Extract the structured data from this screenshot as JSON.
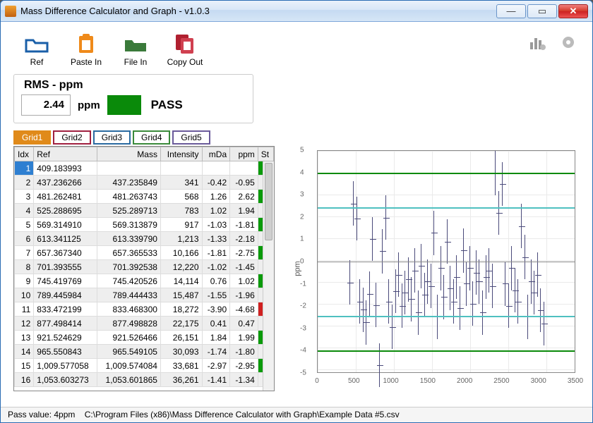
{
  "window": {
    "title": "Mass Difference Calculator and Graph - v1.0.3"
  },
  "toolbar": {
    "ref": "Ref",
    "paste": "Paste In",
    "filein": "File In",
    "copy": "Copy Out"
  },
  "rms": {
    "title": "RMS - ppm",
    "value": "2.44",
    "unit": "ppm",
    "status": "PASS",
    "status_color": "#0a8a0a"
  },
  "tabs": [
    {
      "label": "Grid1",
      "color": "#e08a1a",
      "selected": true
    },
    {
      "label": "Grid2",
      "color": "#a02040",
      "selected": false
    },
    {
      "label": "Grid3",
      "color": "#2a6aa0",
      "selected": false
    },
    {
      "label": "Grid4",
      "color": "#3a8a3a",
      "selected": false
    },
    {
      "label": "Grid5",
      "color": "#6a5a9a",
      "selected": false
    }
  ],
  "grid": {
    "headers": [
      "Idx",
      "Ref",
      "Mass",
      "Intensity",
      "mDa",
      "ppm",
      "St"
    ],
    "rows": [
      {
        "idx": 1,
        "ref": "409.183993",
        "mass": "",
        "intensity": "",
        "mda": "",
        "ppm": "",
        "st": "green"
      },
      {
        "idx": 2,
        "ref": "437.236266",
        "mass": "437.235849",
        "intensity": "341",
        "mda": "-0.42",
        "ppm": "-0.95",
        "st": "green"
      },
      {
        "idx": 3,
        "ref": "481.262481",
        "mass": "481.263743",
        "intensity": "568",
        "mda": "1.26",
        "ppm": "2.62",
        "st": "green"
      },
      {
        "idx": 4,
        "ref": "525.288695",
        "mass": "525.289713",
        "intensity": "783",
        "mda": "1.02",
        "ppm": "1.94",
        "st": "green"
      },
      {
        "idx": 5,
        "ref": "569.314910",
        "mass": "569.313879",
        "intensity": "917",
        "mda": "-1.03",
        "ppm": "-1.81",
        "st": "green"
      },
      {
        "idx": 6,
        "ref": "613.341125",
        "mass": "613.339790",
        "intensity": "1,213",
        "mda": "-1.33",
        "ppm": "-2.18",
        "st": "green"
      },
      {
        "idx": 7,
        "ref": "657.367340",
        "mass": "657.365533",
        "intensity": "10,166",
        "mda": "-1.81",
        "ppm": "-2.75",
        "st": "green"
      },
      {
        "idx": 8,
        "ref": "701.393555",
        "mass": "701.392538",
        "intensity": "12,220",
        "mda": "-1.02",
        "ppm": "-1.45",
        "st": "green"
      },
      {
        "idx": 9,
        "ref": "745.419769",
        "mass": "745.420526",
        "intensity": "14,114",
        "mda": "0.76",
        "ppm": "1.02",
        "st": "green"
      },
      {
        "idx": 10,
        "ref": "789.445984",
        "mass": "789.444433",
        "intensity": "15,487",
        "mda": "-1.55",
        "ppm": "-1.96",
        "st": "green"
      },
      {
        "idx": 11,
        "ref": "833.472199",
        "mass": "833.468300",
        "intensity": "18,272",
        "mda": "-3.90",
        "ppm": "-4.68",
        "st": "red"
      },
      {
        "idx": 12,
        "ref": "877.498414",
        "mass": "877.498828",
        "intensity": "22,175",
        "mda": "0.41",
        "ppm": "0.47",
        "st": "green"
      },
      {
        "idx": 13,
        "ref": "921.524629",
        "mass": "921.526466",
        "intensity": "26,151",
        "mda": "1.84",
        "ppm": "1.99",
        "st": "green"
      },
      {
        "idx": 14,
        "ref": "965.550843",
        "mass": "965.549105",
        "intensity": "30,093",
        "mda": "-1.74",
        "ppm": "-1.80",
        "st": "green"
      },
      {
        "idx": 15,
        "ref": "1,009.577058",
        "mass": "1,009.574084",
        "intensity": "33,681",
        "mda": "-2.97",
        "ppm": "-2.95",
        "st": "green"
      },
      {
        "idx": 16,
        "ref": "1,053.603273",
        "mass": "1,053.601865",
        "intensity": "36,261",
        "mda": "-1.41",
        "ppm": "-1.34",
        "st": "green"
      }
    ]
  },
  "chart_data": {
    "type": "scatter",
    "title": "",
    "xlabel": "",
    "ylabel": "ppm",
    "xlim": [
      0,
      3500
    ],
    "ylim": [
      -5,
      5
    ],
    "xticks": [
      0,
      500,
      1000,
      1500,
      2000,
      2500,
      3000,
      3500
    ],
    "yticks": [
      -5,
      -4,
      -3,
      -2,
      -1,
      0,
      1,
      2,
      3,
      4,
      5
    ],
    "reference_lines": [
      {
        "y": 4.0,
        "color": "#0a8a0a"
      },
      {
        "y": -4.0,
        "color": "#0a8a0a"
      },
      {
        "y": 2.44,
        "color": "#4fc0c0"
      },
      {
        "y": -2.44,
        "color": "#4fc0c0"
      }
    ],
    "series": [
      {
        "name": "ppm",
        "x": [
          437,
          481,
          525,
          569,
          613,
          657,
          701,
          745,
          789,
          833,
          877,
          921,
          965,
          1009,
          1053,
          1097,
          1141,
          1185,
          1229,
          1273,
          1317,
          1361,
          1405,
          1449,
          1493,
          1537,
          1581,
          1625,
          1669,
          1713,
          1757,
          1801,
          1845,
          1889,
          1933,
          1977,
          2021,
          2065,
          2109,
          2153,
          2197,
          2241,
          2285,
          2329,
          2373,
          2417,
          2461,
          2505,
          2549,
          2593,
          2637,
          2681,
          2725,
          2769,
          2813,
          2857,
          2901,
          2945,
          2989,
          3033,
          3077
        ],
        "values": [
          -0.95,
          2.62,
          1.94,
          -1.81,
          -2.18,
          -2.75,
          -1.45,
          1.02,
          -1.96,
          -4.68,
          0.47,
          1.99,
          -1.8,
          -2.95,
          -1.34,
          -0.6,
          -2.0,
          -1.4,
          -0.8,
          -1.7,
          -0.4,
          -2.3,
          -0.2,
          -1.5,
          -0.9,
          -1.1,
          1.3,
          -2.5,
          -0.3,
          -1.6,
          0.9,
          -1.2,
          -1.8,
          -0.7,
          -2.1,
          0.5,
          -1.0,
          -0.3,
          -1.9,
          -0.5,
          -0.9,
          -2.3,
          -0.7,
          -0.4,
          -1.1,
          4.0,
          2.2,
          3.5,
          -1.0,
          -2.0,
          -0.3,
          -1.3,
          -1.8,
          1.6,
          0.2,
          -2.5,
          -0.9,
          -1.4,
          -0.6,
          -2.2,
          -2.8
        ],
        "err": 1.0
      }
    ]
  },
  "status": {
    "pass_label": "Pass value: 4ppm",
    "filepath": "C:\\Program Files (x86)\\Mass Difference Calculator with Graph\\Example Data #5.csv"
  }
}
